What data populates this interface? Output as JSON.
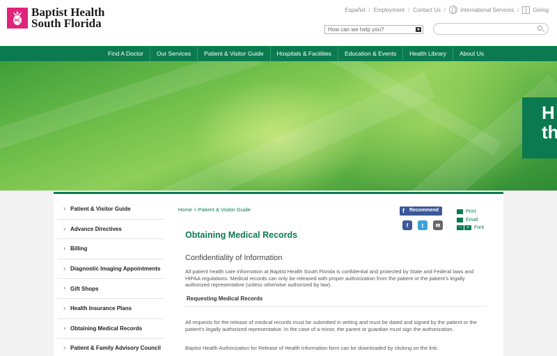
{
  "header": {
    "logo_line1": "Baptist Health",
    "logo_line2": "South Florida",
    "utility_links": [
      "Español",
      "Employment",
      "Contact Us",
      "International Services",
      "Giving"
    ],
    "help_select": "How can we help you?",
    "search_placeholder": ""
  },
  "nav": {
    "items": [
      "Find A Doctor",
      "Our Services",
      "Patient & Visitor Guide",
      "Hospitals & Facilities",
      "Education & Events",
      "Health Library",
      "About Us"
    ]
  },
  "hero": {
    "card_text_line1": "H",
    "card_text_line2": "th"
  },
  "sidebar": {
    "items": [
      "Patient & Visitor Guide",
      "Advance Directives",
      "Billing",
      "Diagnostic Imaging Appointments",
      "Gift Shops",
      "Health Insurance Plans",
      "Obtaining Medical Records",
      "Patient & Family Advisory Council"
    ]
  },
  "main": {
    "breadcrumb": "Home > Patient & Visitor Guide",
    "recommend_label": "Recommend",
    "tools": {
      "print": "Print",
      "email": "Email",
      "font": "Font"
    },
    "title": "Obtaining Medical Records",
    "section_title": "Confidentiality of Information",
    "para1": "All patient health care information at Baptist Health South Florida is confidential and protected by State and Federal laws and HIPAA regulations. Medical records can only be released with proper authorization from the patient or the patient’s legally authorized representative (unless otherwise authorized by law).",
    "sub_title": "Requesting Medical Records",
    "para2": "All requests for the release of medical records must be submitted in writing and must be dated and signed by the patient or the patient’s legally authorized representative. In the case of a minor, the parent or guardian must sign the authorization.",
    "para3": "Baptist Health Authorization for Release of Health Information form can be downloaded by clicking on the link:"
  },
  "colors": {
    "brand_green": "#0b7a50",
    "logo_pink": "#e0237c",
    "facebook_blue": "#3b5998"
  }
}
